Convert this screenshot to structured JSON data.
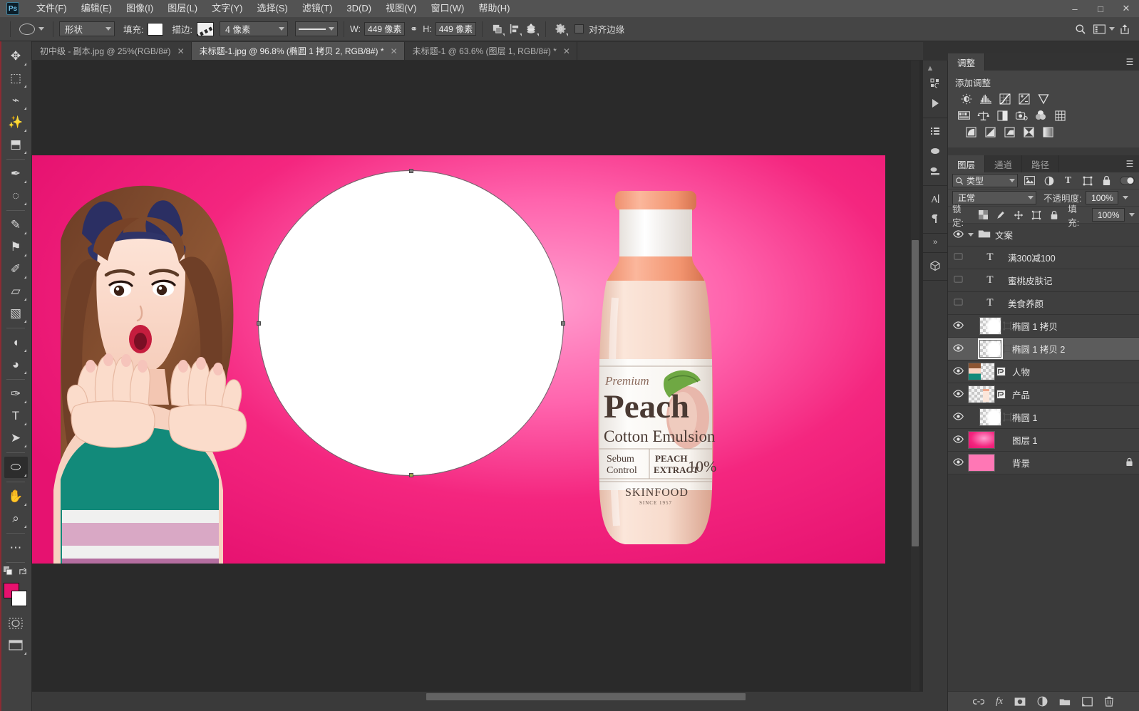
{
  "app": {
    "logo_text": "Ps",
    "window_controls": {
      "minimize": "–",
      "maximize": "□",
      "close": "✕"
    }
  },
  "menubar": {
    "items": [
      {
        "label": "文件(F)",
        "name": "menu-file"
      },
      {
        "label": "编辑(E)",
        "name": "menu-edit"
      },
      {
        "label": "图像(I)",
        "name": "menu-image"
      },
      {
        "label": "图层(L)",
        "name": "menu-layer"
      },
      {
        "label": "文字(Y)",
        "name": "menu-type"
      },
      {
        "label": "选择(S)",
        "name": "menu-select"
      },
      {
        "label": "滤镜(T)",
        "name": "menu-filter"
      },
      {
        "label": "3D(D)",
        "name": "menu-3d"
      },
      {
        "label": "视图(V)",
        "name": "menu-view"
      },
      {
        "label": "窗口(W)",
        "name": "menu-window"
      },
      {
        "label": "帮助(H)",
        "name": "menu-help"
      }
    ]
  },
  "options_bar": {
    "mode_value": "形状",
    "fill_label": "填充:",
    "fill_color": "#ffffff",
    "stroke_label": "描边:",
    "stroke_width": "4 像素",
    "width_label": "W:",
    "width_value": "449 像素",
    "link_glyph": "⚭",
    "height_label": "H:",
    "height_value": "449 像素",
    "align_edges_label": "对齐边缘",
    "align_edges_checked": false,
    "gear_icon": "gear-icon",
    "search_icon": "search-icon",
    "workspace_icon": "workspace-icon",
    "share_icon": "share-icon"
  },
  "tabs": [
    {
      "label": "初中级 - 副本.jpg @ 25%(RGB/8#)",
      "active": false,
      "close": "✕"
    },
    {
      "label": "未标题-1.jpg @ 96.8% (椭圆 1 拷贝 2, RGB/8#) *",
      "active": true,
      "close": "✕"
    },
    {
      "label": "未标题-1 @ 63.6% (图层 1, RGB/8#) *",
      "active": false,
      "close": "✕"
    }
  ],
  "toolbar": {
    "tools": [
      {
        "name": "move-tool",
        "glyph": "✥"
      },
      {
        "name": "rectangular-marquee-tool",
        "glyph": "⬚"
      },
      {
        "name": "lasso-tool",
        "glyph": "⌁"
      },
      {
        "name": "magic-wand-tool",
        "glyph": "✨"
      },
      {
        "name": "crop-tool",
        "glyph": "⬒"
      },
      {
        "name": "eyedropper-tool",
        "glyph": "✒"
      },
      {
        "name": "spot-healing-brush-tool",
        "glyph": "◌"
      },
      {
        "name": "brush-tool",
        "glyph": "✎"
      },
      {
        "name": "clone-stamp-tool",
        "glyph": "⚑"
      },
      {
        "name": "history-brush-tool",
        "glyph": "✐"
      },
      {
        "name": "eraser-tool",
        "glyph": "▱"
      },
      {
        "name": "gradient-tool",
        "glyph": "▧"
      },
      {
        "name": "blur-tool",
        "glyph": "◖"
      },
      {
        "name": "dodge-tool",
        "glyph": "◕"
      },
      {
        "name": "pen-tool",
        "glyph": "✑"
      },
      {
        "name": "type-tool",
        "glyph": "T"
      },
      {
        "name": "path-selection-tool",
        "glyph": "➤"
      },
      {
        "name": "ellipse-tool",
        "glyph": "⬭",
        "selected": true
      },
      {
        "name": "hand-tool",
        "glyph": "✋"
      },
      {
        "name": "zoom-tool",
        "glyph": "⌕"
      },
      {
        "name": "more-tools",
        "glyph": "⋯"
      }
    ],
    "foreground_color": "#e8116e",
    "background_color": "#ffffff",
    "quickmask_icon": "quick-mask-icon",
    "screenmode_icon": "screen-mode-icon",
    "swap_icon": "swap-colors-icon"
  },
  "canvas": {
    "zoom": "96.8%",
    "bottle": {
      "premium": "Premium",
      "brand": "Peach",
      "subtitle": "Cotton Emulsion",
      "left_line1": "Sebum",
      "left_line2": "Control",
      "right_line1": "PEACH",
      "right_line2": "EXTRACT",
      "percent": "10%",
      "maker": "SKINFOOD",
      "since": "SINCE 1957"
    }
  },
  "adjustments_panel": {
    "tab_label": "调整",
    "section_title": "添加调整",
    "row1": [
      "brightness-contrast-icon",
      "levels-icon",
      "curves-icon",
      "exposure-icon",
      "vibrance-icon"
    ],
    "row2": [
      "hue-saturation-icon",
      "color-balance-icon",
      "black-white-icon",
      "photo-filter-icon",
      "channel-mixer-icon",
      "color-lookup-icon"
    ],
    "row3": [
      "invert-icon",
      "posterize-icon",
      "threshold-icon",
      "selective-color-icon",
      "gradient-map-icon"
    ],
    "menu_icon": "panel-menu-icon"
  },
  "layers_panel": {
    "tabs": [
      {
        "label": "图层",
        "active": true
      },
      {
        "label": "通道",
        "active": false
      },
      {
        "label": "路径",
        "active": false
      }
    ],
    "filter_value": "类型",
    "filter_icons": [
      "pixel-filter-icon",
      "adjustment-filter-icon",
      "type-filter-icon",
      "shape-filter-icon",
      "smart-object-filter-icon",
      "filter-toggle-icon"
    ],
    "blend_mode": "正常",
    "opacity_label": "不透明度:",
    "opacity_value": "100%",
    "lock_label": "锁定:",
    "lock_icons": [
      "lock-transparent-icon",
      "lock-image-icon",
      "lock-position-icon",
      "lock-artboard-icon",
      "lock-all-icon"
    ],
    "fill_label": "填充:",
    "fill_value": "100%",
    "layers": [
      {
        "name": "文案",
        "type": "group",
        "visible": true,
        "selected": false,
        "expanded": true
      },
      {
        "name": "满300减100",
        "type": "text",
        "visible": false,
        "selected": false,
        "child": true
      },
      {
        "name": "蜜桃皮肤记",
        "type": "text",
        "visible": false,
        "selected": false,
        "child": true
      },
      {
        "name": "美食养颜",
        "type": "text",
        "visible": false,
        "selected": false,
        "child": true
      },
      {
        "name": "椭圆 1 拷贝",
        "type": "shape",
        "visible": true,
        "selected": false,
        "child": true
      },
      {
        "name": "椭圆 1 拷贝 2",
        "type": "shape",
        "visible": true,
        "selected": true,
        "child": true
      },
      {
        "name": "人物",
        "type": "smart",
        "visible": true,
        "selected": false
      },
      {
        "name": "产品",
        "type": "smart",
        "visible": true,
        "selected": false
      },
      {
        "name": "椭圆 1",
        "type": "shape",
        "visible": true,
        "selected": false
      },
      {
        "name": "图层 1",
        "type": "pixel",
        "visible": true,
        "selected": false
      },
      {
        "name": "背景",
        "type": "background",
        "visible": true,
        "selected": false,
        "locked": true
      }
    ],
    "bottom_icons": [
      "link-layers-icon",
      "layer-style-icon",
      "layer-mask-icon",
      "new-fill-adjustment-icon",
      "new-group-icon",
      "new-layer-icon",
      "delete-layer-icon"
    ],
    "fx_label": "fx"
  },
  "dock_strip": {
    "groups": [
      [
        "history-icon",
        "actions-icon"
      ],
      [
        "properties-icon",
        "brush-icon",
        "brush-presets-icon"
      ],
      [
        "character-icon",
        "paragraph-icon"
      ],
      [
        "3d-icon"
      ]
    ],
    "collapse_icon": "collapse-panel-icon",
    "expand_icon": "expand-panel-icon"
  },
  "colors": {
    "titlebar": "#535353",
    "optionsbar": "#454545",
    "panel_bg": "#3a3a3a",
    "canvas_bg": "#2a2a2a",
    "accent_pink": "#e8116e",
    "selected_layer": "#5c5c5c"
  }
}
